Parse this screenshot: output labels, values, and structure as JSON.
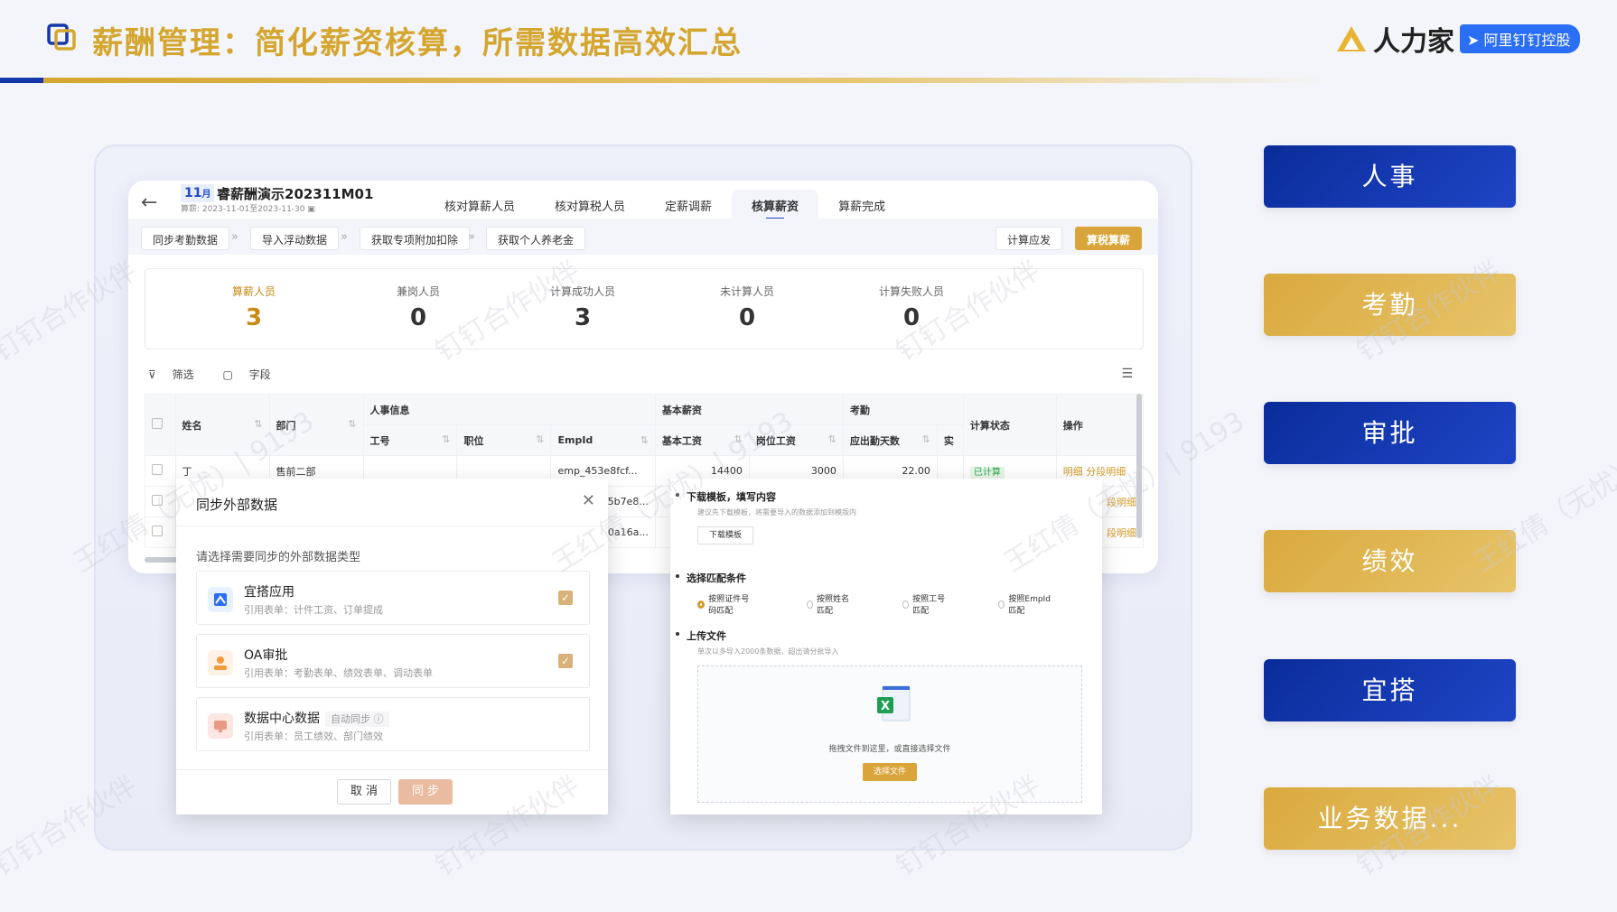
{
  "header": {
    "title": "薪酬管理：简化薪资核算，所需数据高效汇总",
    "brand_name": "人力家",
    "brand_tag": "阿里钉钉控股"
  },
  "colors": {
    "gold": "#d4a630",
    "navy": "#1537a8"
  },
  "window": {
    "month_num": "11",
    "month_unit": "月",
    "title": "睿薪酬演示202311M01",
    "period": "算薪: 2023-11-01至2023-11-30",
    "tabs": [
      "核对算薪人员",
      "核对算税人员",
      "定薪调薪",
      "核算薪资",
      "算薪完成"
    ],
    "active_tab": "核算薪资",
    "toolbar": {
      "sync_attendance": "同步考勤数据",
      "import_floating": "导入浮动数据",
      "get_deductions": "获取专项附加扣除",
      "get_pension": "获取个人养老金",
      "calc_payable": "计算应发",
      "calc_tax": "算税算薪"
    },
    "stats": [
      {
        "label": "算薪人员",
        "value": "3"
      },
      {
        "label": "兼岗人员",
        "value": "0"
      },
      {
        "label": "计算成功人员",
        "value": "3"
      },
      {
        "label": "未计算人员",
        "value": "0"
      },
      {
        "label": "计算失败人员",
        "value": "0"
      }
    ],
    "filter_label": "筛选",
    "field_label": "字段",
    "table": {
      "groups": {
        "hr_info": "人事信息",
        "base_salary": "基本薪资",
        "attendance": "考勤"
      },
      "cols": {
        "name": "姓名",
        "dept": "部门",
        "emp_no": "工号",
        "position": "职位",
        "empid": "EmpId",
        "base_pay": "基本工资",
        "post_pay": "岗位工资",
        "work_days": "应出勤天数",
        "trunc": "实",
        "status": "计算状态",
        "ops": "操作"
      },
      "rows": [
        {
          "name": "丁",
          "dept": "售前二部",
          "empid": "emp_453e8fcf...",
          "base_pay": "14400",
          "post_pay": "3000",
          "work_days": "22.00",
          "status": "已计算",
          "op1": "明细",
          "op2": "分段明细"
        },
        {
          "name": "",
          "dept": "",
          "empid": "5b7e8...",
          "base_pay": "",
          "post_pay": "",
          "work_days": "",
          "status": "",
          "op1": "",
          "op2": "段明细"
        },
        {
          "name": "",
          "dept": "",
          "empid": "90a16a...",
          "base_pay": "",
          "post_pay": "",
          "work_days": "",
          "status": "",
          "op1": "",
          "op2": "段明细"
        }
      ]
    }
  },
  "sync_dialog": {
    "title": "同步外部数据",
    "subtitle": "请选择需要同步的外部数据类型",
    "options": [
      {
        "name": "宜搭应用",
        "desc": "引用表单：计件工资、订单提成",
        "checked": true
      },
      {
        "name": "OA审批",
        "desc": "引用表单：考勤表单、绩效表单、调动表单",
        "checked": true
      },
      {
        "name": "数据中心数据",
        "badge": "自动同步",
        "desc": "引用表单：员工绩效、部门绩效",
        "checked": false
      }
    ],
    "cancel": "取 消",
    "confirm": "同 步"
  },
  "upload_dialog": {
    "step1_title": "下载模板，填写内容",
    "step1_desc": "建议先下载模板，将需要导入的数据添加到模版内",
    "download_btn": "下载模板",
    "step2_title": "选择匹配条件",
    "match_options": [
      "按照证件号码匹配",
      "按照姓名匹配",
      "按照工号匹配",
      "按照EmpId匹配"
    ],
    "step3_title": "上传文件",
    "step3_desc": "单次以多导入2000条数据，超出请分批导入",
    "drop_text": "拖拽文件到这里，或直接选择文件",
    "choose_btn": "选择文件"
  },
  "nav": [
    "人事",
    "考勤",
    "审批",
    "绩效",
    "宜搭",
    "业务数据..."
  ],
  "watermarks": [
    "钉钉合作伙伴",
    "王红倩（无忧）| 9193"
  ]
}
